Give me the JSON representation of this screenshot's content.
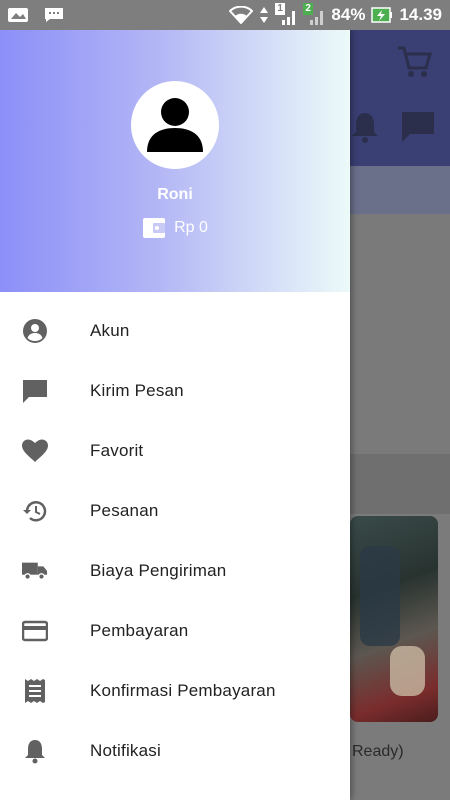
{
  "status_bar": {
    "battery": "84%",
    "time": "14.39",
    "sim1": "1",
    "sim2": "2"
  },
  "drawer": {
    "user_name": "Roni",
    "balance": "Rp 0",
    "items": [
      {
        "label": "Akun",
        "icon": "account-circle-icon"
      },
      {
        "label": "Kirim Pesan",
        "icon": "message-icon"
      },
      {
        "label": "Favorit",
        "icon": "heart-icon"
      },
      {
        "label": "Pesanan",
        "icon": "history-icon"
      },
      {
        "label": "Biaya Pengiriman",
        "icon": "truck-icon"
      },
      {
        "label": "Pembayaran",
        "icon": "credit-card-icon"
      },
      {
        "label": "Konfirmasi Pembayaran",
        "icon": "receipt-icon"
      },
      {
        "label": "Notifikasi",
        "icon": "bell-icon"
      }
    ]
  },
  "background": {
    "partial_text": "Ready)"
  }
}
